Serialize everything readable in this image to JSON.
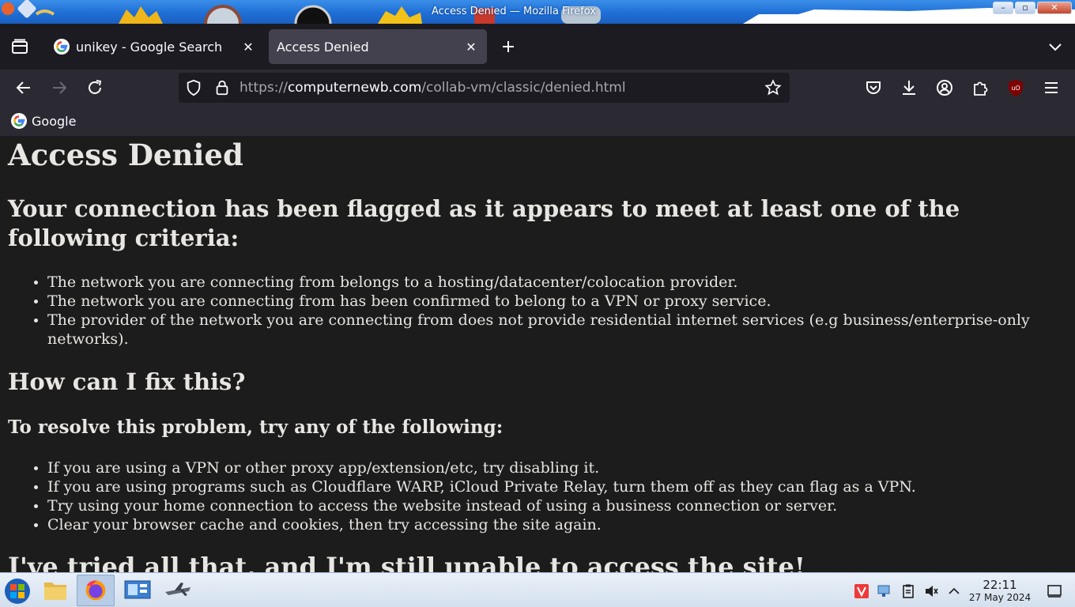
{
  "window": {
    "title": "Access Denied — Mozilla Firefox",
    "minimize": "–",
    "maximize": "▫",
    "close": "✕"
  },
  "tabs": [
    {
      "label": "unikey - Google Search",
      "close": "✕",
      "active": false
    },
    {
      "label": "Access Denied",
      "close": "✕",
      "active": true
    }
  ],
  "urlbar": {
    "scheme": "https://",
    "host": "computernewb.com",
    "path": "/collab-vm/classic/denied.html"
  },
  "bookmarks": [
    {
      "label": "Google"
    }
  ],
  "page": {
    "title": "Access Denied",
    "flag_heading": "Your connection has been flagged as it appears to meet at least one of the following criteria:",
    "criteria": [
      "The network you are connecting from belongs to a hosting/datacenter/colocation provider.",
      "The network you are connecting from has been confirmed to belong to a VPN or proxy service.",
      "The provider of the network you are connecting from does not provide residential internet services (e.g business/enterprise-only networks)."
    ],
    "fix_heading": "How can I fix this?",
    "fix_subheading": "To resolve this problem, try any of the following:",
    "fixes": [
      "If you are using a VPN or other proxy app/extension/etc, try disabling it.",
      "If you are using programs such as Cloudflare WARP, iCloud Private Relay, turn them off as they can flag as a VPN.",
      "Try using your home connection to access the website instead of using a business connection or server.",
      "Clear your browser cache and cookies, then try accessing the site again."
    ],
    "still_heading": "I've tried all that, and I'm still unable to access the site!"
  },
  "taskbar": {
    "apps": [
      "start-orb",
      "file-manager",
      "firefox",
      "control-panel",
      "airplane-app"
    ],
    "clock": {
      "time": "22:11",
      "date": "27 May 2024"
    }
  },
  "colors": {
    "page_bg": "#1c1c1c",
    "page_text": "#e8e6e3",
    "toolbar_bg": "#2b2a33",
    "tab_strip_bg": "#1c1b22",
    "active_tab_bg": "#42414d",
    "titlebar_blue": "#1f6fd6"
  }
}
